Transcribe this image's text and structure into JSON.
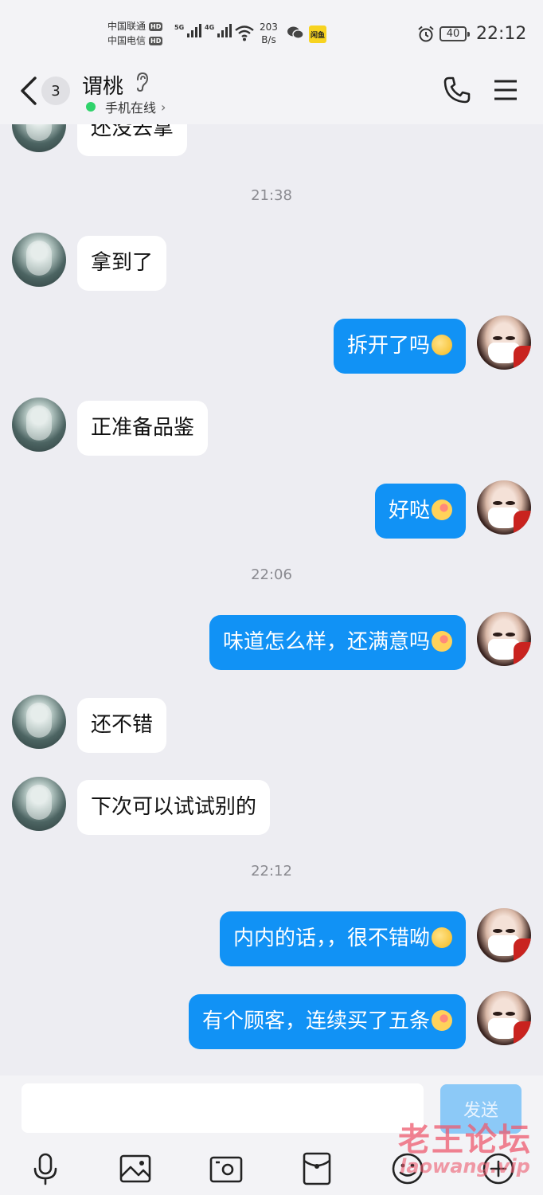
{
  "status_bar": {
    "carrier1": "中国联通",
    "carrier2": "中国电信",
    "hd": "HD",
    "net1": "5G",
    "net2": "4G",
    "speed_value": "203",
    "speed_unit": "B/s",
    "notification_badge": "闲鱼",
    "battery": "40",
    "time": "22:12"
  },
  "header": {
    "unread_count": "3",
    "contact_name": "谓桃",
    "presence": "手机在线"
  },
  "messages": [
    {
      "type": "message",
      "side": "them",
      "text": "还没去拿"
    },
    {
      "type": "time",
      "text": "21:38"
    },
    {
      "type": "message",
      "side": "them",
      "text": "拿到了"
    },
    {
      "type": "message",
      "side": "me",
      "text": "拆开了吗",
      "emoji": "shy-emoji"
    },
    {
      "type": "message",
      "side": "them",
      "text": "正准备品鉴"
    },
    {
      "type": "message",
      "side": "me",
      "text": "好哒",
      "emoji": "candy-emoji"
    },
    {
      "type": "time",
      "text": "22:06"
    },
    {
      "type": "message",
      "side": "me",
      "text": "味道怎么样，还满意吗",
      "emoji": "candy-emoji"
    },
    {
      "type": "message",
      "side": "them",
      "text": "还不错"
    },
    {
      "type": "message",
      "side": "them",
      "text": "下次可以试试别的"
    },
    {
      "type": "time",
      "text": "22:12"
    },
    {
      "type": "message",
      "side": "me",
      "text": "内内的话，，很不错呦",
      "emoji": "shy-emoji"
    },
    {
      "type": "message",
      "side": "me",
      "text": "有个顾客，连续买了五条",
      "emoji": "candy-emoji"
    }
  ],
  "input": {
    "value": "",
    "send_label": "发送"
  },
  "toolbar": [
    "microphone-icon",
    "image-icon",
    "camera-icon",
    "red-packet-icon",
    "emoji-icon",
    "plus-icon"
  ],
  "watermark": {
    "line1": "老王论坛",
    "line2": "laowang.vip"
  },
  "colors": {
    "my_bubble": "#1192f5",
    "their_bubble": "#ffffff",
    "background": "#ededf2",
    "send_button": "#8cc9f7",
    "online_dot": "#2fd36b"
  }
}
